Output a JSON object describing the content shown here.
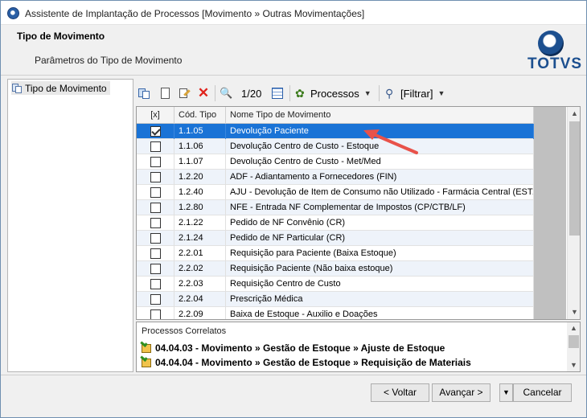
{
  "window": {
    "title": "Assistente de Implantação de Processos [Movimento » Outras Movimentações]"
  },
  "header": {
    "title": "Tipo de Movimento",
    "subtitle": "Parâmetros do Tipo de Movimento",
    "logo_text": "TOTVS"
  },
  "tree": {
    "items": [
      {
        "label": "Tipo de Movimento"
      }
    ]
  },
  "toolbar": {
    "record_counter": "1/20",
    "processes_label": "Processos",
    "filter_label": "[Filtrar]",
    "delete_glyph": "✕",
    "find_glyph": "🔍",
    "processes_glyph": "✿",
    "filter_glyph": "⚲",
    "icons": [
      "import-icon",
      "new-icon",
      "edit-icon",
      "delete-icon",
      "find-icon",
      "grid-icon",
      "processes-icon",
      "filter-icon"
    ]
  },
  "grid": {
    "columns": [
      "[x]",
      "Cód. Tipo",
      "Nome Tipo de Movimento"
    ],
    "rows": [
      {
        "checked": true,
        "code": "1.1.05",
        "name": "Devolução Paciente"
      },
      {
        "checked": false,
        "code": "1.1.06",
        "name": "Devolução Centro de Custo - Estoque"
      },
      {
        "checked": false,
        "code": "1.1.07",
        "name": "Devolução Centro de Custo - Met/Med"
      },
      {
        "checked": false,
        "code": "1.2.20",
        "name": "ADF - Adiantamento a Fornecedores (FIN)"
      },
      {
        "checked": false,
        "code": "1.2.40",
        "name": "AJU - Devolução de Item de Consumo não Utilizado - Farmácia Central (EST/..."
      },
      {
        "checked": false,
        "code": "1.2.80",
        "name": "NFE - Entrada NF Complementar de Impostos (CP/CTB/LF)"
      },
      {
        "checked": false,
        "code": "2.1.22",
        "name": "Pedido de NF Convênio (CR)"
      },
      {
        "checked": false,
        "code": "2.1.24",
        "name": "Pedido de NF Particular (CR)"
      },
      {
        "checked": false,
        "code": "2.2.01",
        "name": "Requisição para Paciente (Baixa Estoque)"
      },
      {
        "checked": false,
        "code": "2.2.02",
        "name": "Requisição Paciente (Não baixa estoque)"
      },
      {
        "checked": false,
        "code": "2.2.03",
        "name": "Requisição Centro de Custo"
      },
      {
        "checked": false,
        "code": "2.2.04",
        "name": "Prescrição Médica"
      },
      {
        "checked": false,
        "code": "2.2.09",
        "name": "Baixa de Estoque - Auxilio e Doações"
      }
    ],
    "selected_index": 0,
    "scroll_up_glyph": "▲",
    "scroll_down_glyph": "▼"
  },
  "related": {
    "title": "Processos Correlatos",
    "items": [
      {
        "label": "04.04.03 - Movimento » Gestão de Estoque » Ajuste de Estoque"
      },
      {
        "label": "04.04.04 - Movimento » Gestão de Estoque » Requisição de Materiais"
      }
    ]
  },
  "footer": {
    "back_label": "< Voltar",
    "next_label": "Avançar >",
    "dropdown_glyph": "▼",
    "cancel_label": "Cancelar"
  },
  "colors": {
    "selection": "#1a73d6",
    "row_alt": "#eef3fa",
    "annotation_arrow": "#e8524a",
    "brand": "#1c4f8f"
  }
}
